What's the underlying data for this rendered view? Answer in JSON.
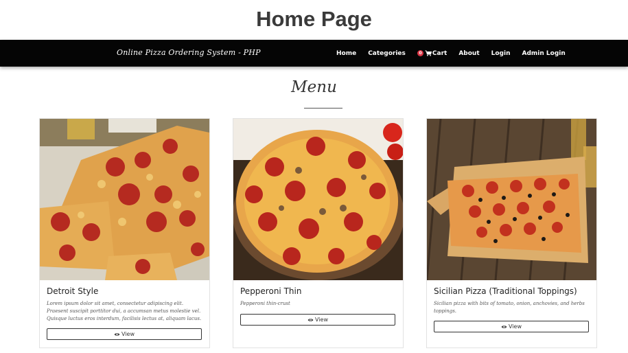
{
  "page": {
    "heading": "Home Page"
  },
  "navbar": {
    "brand": "Online Pizza Ordering System - PHP",
    "links": {
      "home": "Home",
      "categories": "Categories",
      "cart_count": "0",
      "cart": "Cart",
      "about": "About",
      "login": "Login",
      "admin_login": "Admin Login"
    }
  },
  "menu": {
    "title": "Menu"
  },
  "cards": [
    {
      "title": "Detroit Style",
      "description": "Lorem ipsum dolor sit amet, consectetur adipiscing elit. Praesent suscipit porttitor dui, a accumsan metus molestie vel. Quisque luctus eros interdum, facilisis lectus at, aliquam lacus.",
      "button": "View",
      "image_icon": "detroit-pizza-image"
    },
    {
      "title": "Pepperoni Thin",
      "description": "Pepperoni thin-crust",
      "button": "View",
      "image_icon": "pepperoni-pizza-image"
    },
    {
      "title": "Sicilian Pizza (Traditional Toppings)",
      "description": "Sicilian pizza with bits of tomato, onion, anchovies, and herbs toppings.",
      "button": "View",
      "image_icon": "sicilian-pizza-image"
    }
  ],
  "colors": {
    "navbar_bg": "#050505",
    "badge_bg": "#dc3545",
    "pepperoni": "#b8261d",
    "crust": "#e8a64a",
    "wood": "#6b4a2f"
  }
}
